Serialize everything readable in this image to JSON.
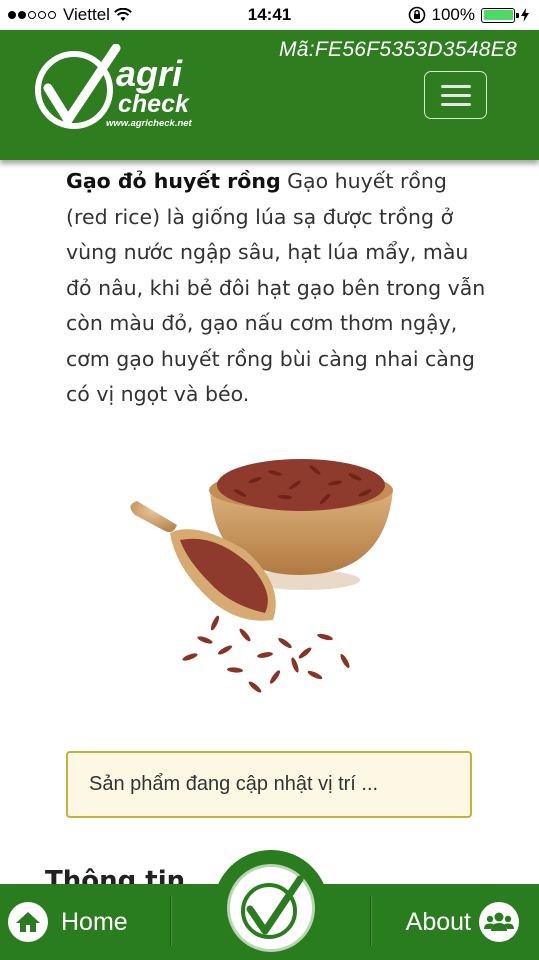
{
  "status_bar": {
    "carrier": "Viettel",
    "time": "14:41",
    "battery": "100%"
  },
  "header": {
    "logo_text_1": "agri",
    "logo_text_2": "check",
    "logo_url": "www.agricheck.net",
    "product_code": "Mã:FE56F5353D3548E8",
    "brand_color": "#2e7d1f"
  },
  "product": {
    "name": "Gạo đỏ huyết rồng",
    "description": " Gạo huyết rồng (red rice) là giống lúa sạ được trồng ở vùng nước ngập sâu, hạt lúa mẩy, màu đỏ nâu, khi bẻ đôi hạt gạo bên trong vẫn còn màu đỏ, gạo nấu cơm thơm ngậy, cơm gạo huyết rồng bùi càng nhai càng có vị ngọt và béo."
  },
  "notice": {
    "text": "Sản phẩm đang cập nhật vị trí ..."
  },
  "section": {
    "title": "Thông tin"
  },
  "bottom_nav": {
    "home_label": "Home",
    "about_label": "About"
  }
}
